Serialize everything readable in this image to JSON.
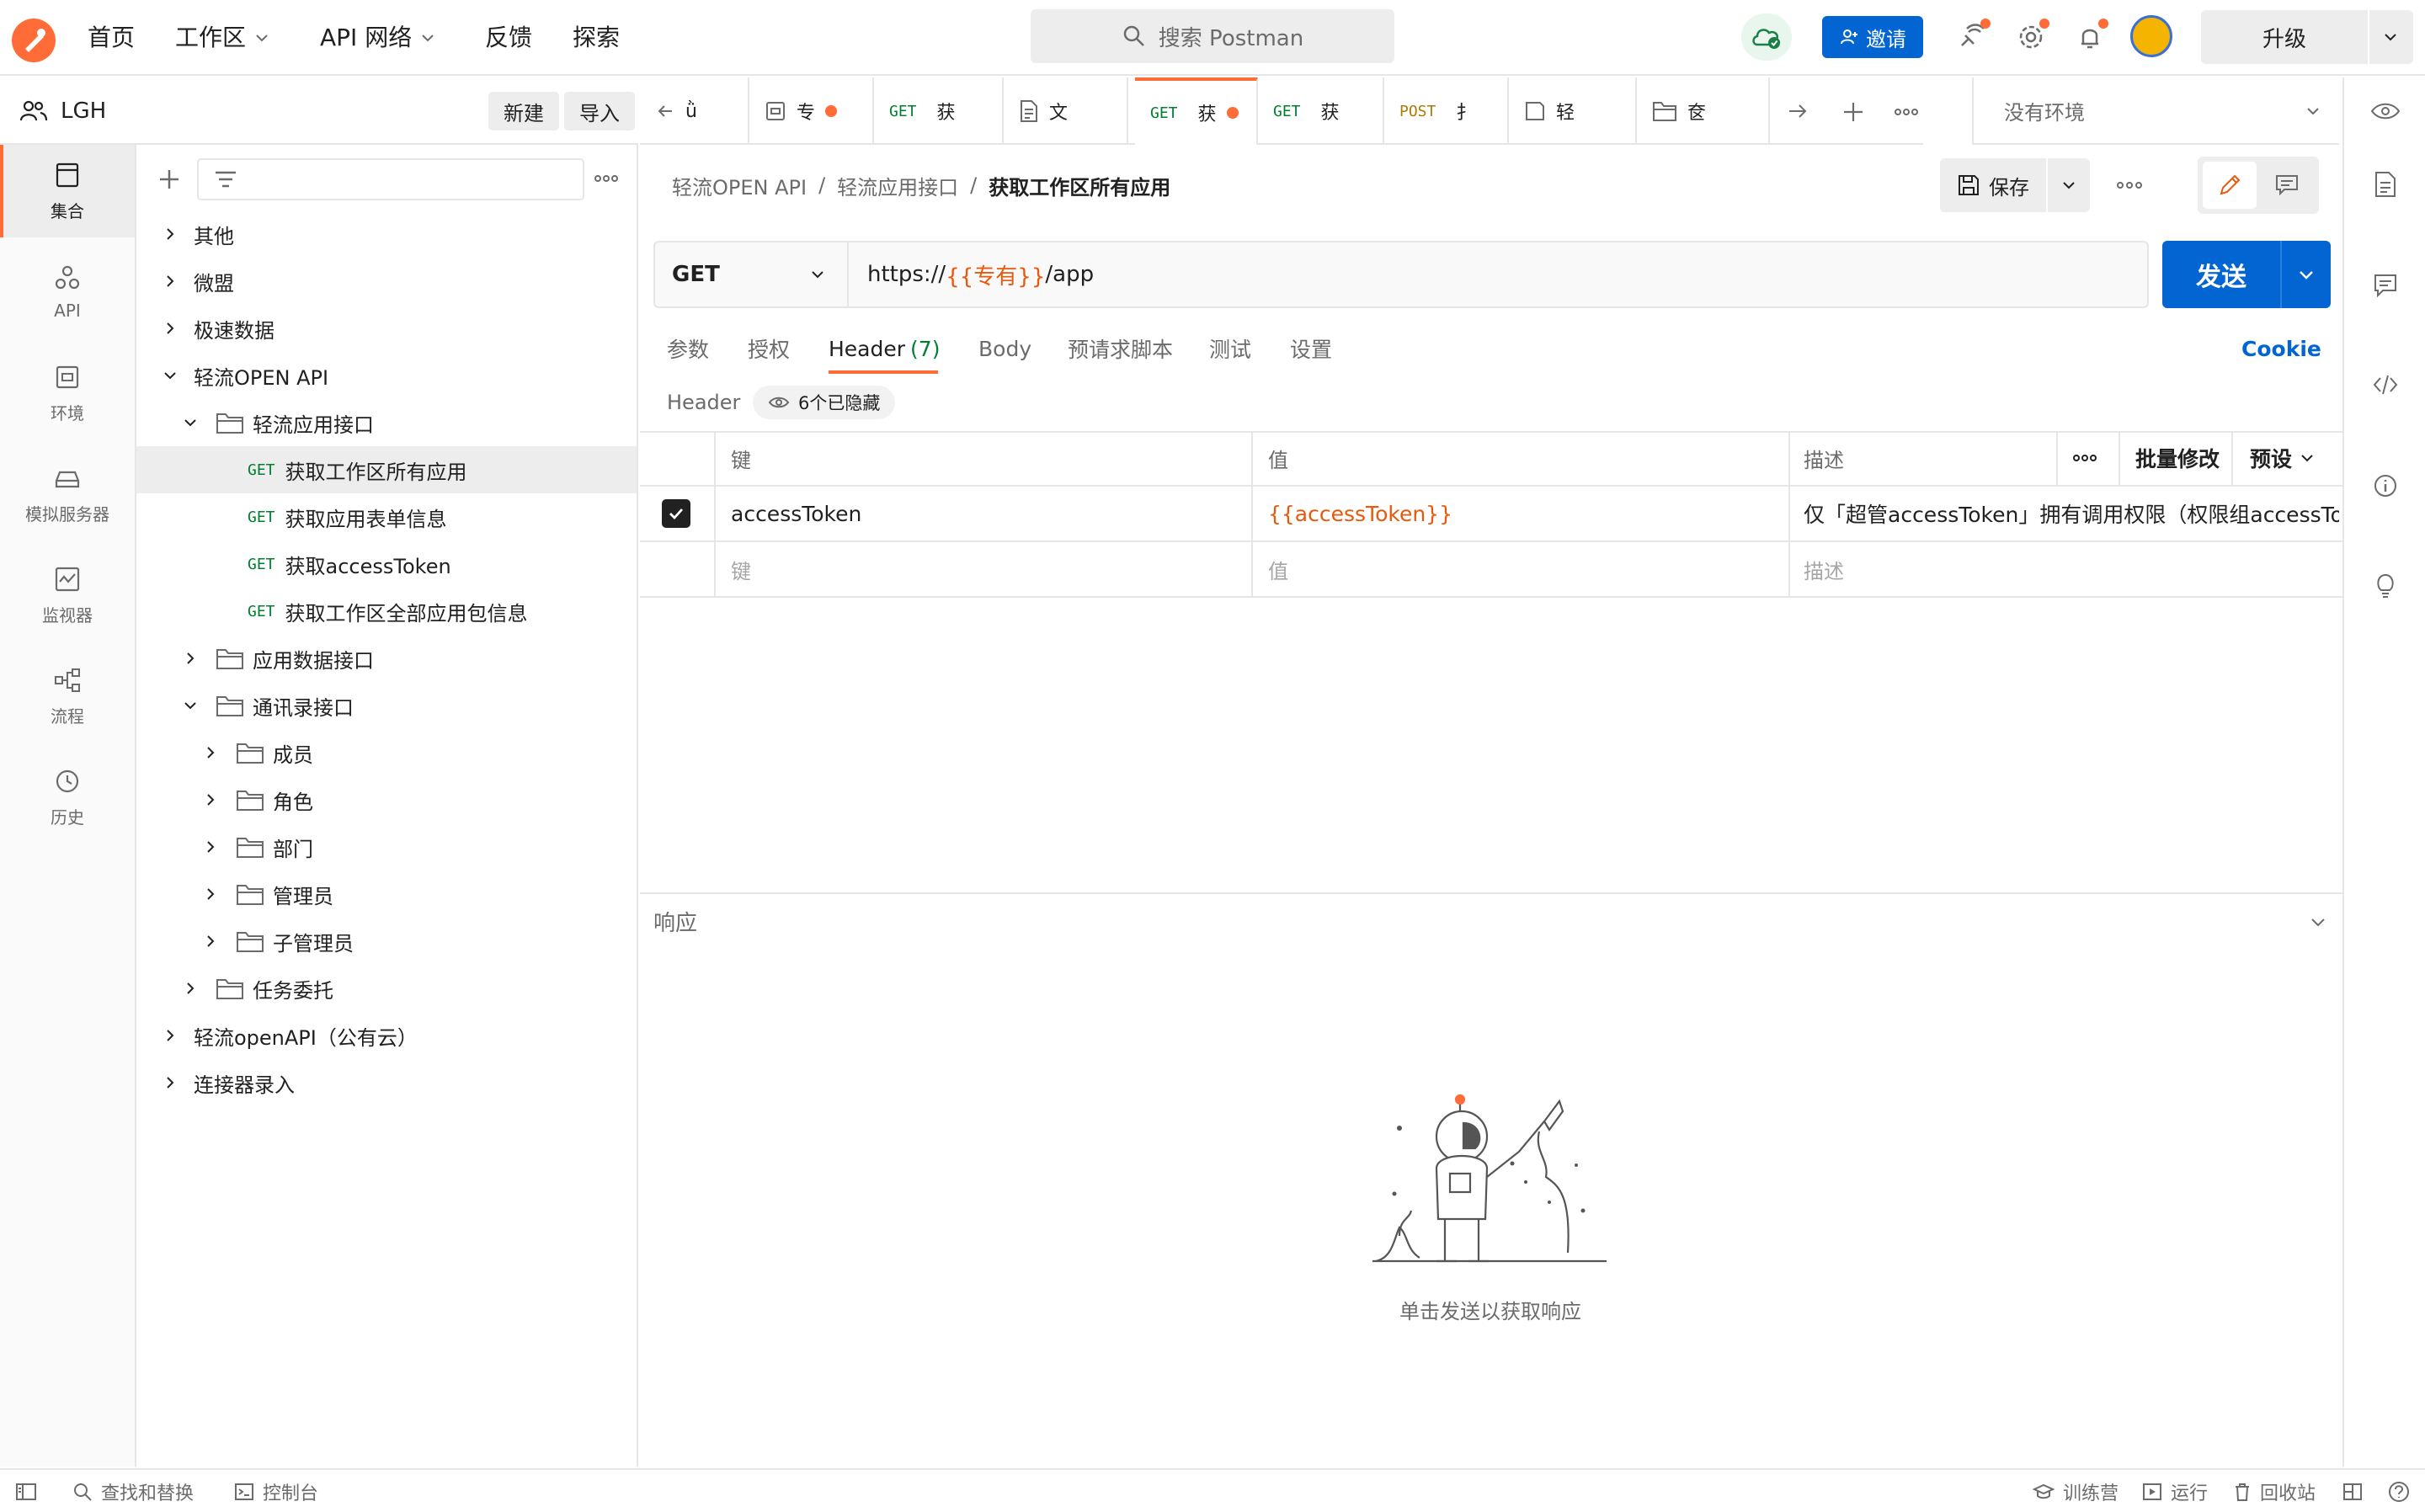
{
  "topnav": {
    "home": "首页",
    "workspaces": "工作区",
    "api_network": "API 网络",
    "feedback": "反馈",
    "explore": "探索",
    "search_placeholder": "搜索 Postman",
    "invite": "邀请",
    "upgrade": "升级"
  },
  "workspace": {
    "name": "LGH",
    "new_btn": "新建",
    "import_btn": "导入"
  },
  "rail": [
    {
      "label": "集合",
      "icon": "collections-icon"
    },
    {
      "label": "API",
      "icon": "api-icon"
    },
    {
      "label": "环境",
      "icon": "environment-icon"
    },
    {
      "label": "模拟服务器",
      "icon": "mock-server-icon"
    },
    {
      "label": "监视器",
      "icon": "monitor-icon"
    },
    {
      "label": "流程",
      "icon": "flow-icon"
    },
    {
      "label": "历史",
      "icon": "history-icon"
    }
  ],
  "tree": [
    {
      "label": "其他"
    },
    {
      "label": "微盟"
    },
    {
      "label": "极速数据"
    },
    {
      "label": "轻流OPEN API"
    },
    {
      "label": "轻流应用接口"
    },
    {
      "method": "GET",
      "label": "获取工作区所有应用"
    },
    {
      "method": "GET",
      "label": "获取应用表单信息"
    },
    {
      "method": "GET",
      "label": "获取accessToken"
    },
    {
      "method": "GET",
      "label": "获取工作区全部应用包信息"
    },
    {
      "label": "应用数据接口"
    },
    {
      "label": "通讯录接口"
    },
    {
      "label": "成员"
    },
    {
      "label": "角色"
    },
    {
      "label": "部门"
    },
    {
      "label": "管理员"
    },
    {
      "label": "子管理员"
    },
    {
      "label": "任务委托"
    },
    {
      "label": "轻流openAPI（公有云）"
    },
    {
      "label": "连接器录入"
    }
  ],
  "tabs": [
    {
      "method": "",
      "label": "ǜ"
    },
    {
      "method": "",
      "label": "专"
    },
    {
      "method": "GET",
      "label": "获"
    },
    {
      "method": "",
      "label": "文"
    },
    {
      "method": "GET",
      "label": "获"
    },
    {
      "method": "GET",
      "label": "获"
    },
    {
      "method": "POST",
      "label": "扌"
    },
    {
      "method": "",
      "label": "轻"
    },
    {
      "method": "",
      "label": "奁"
    }
  ],
  "environment": "没有环境",
  "breadcrumb": {
    "collection": "轻流OPEN API",
    "folder": "轻流应用接口",
    "request": "获取工作区所有应用",
    "sep": "/"
  },
  "save": "保存",
  "request": {
    "method": "GET",
    "url_prefix": "https://",
    "url_var": "{{专有}}",
    "url_suffix": "/app",
    "send": "发送"
  },
  "req_tabs": {
    "params": "参数",
    "auth": "授权",
    "headers": "Header",
    "headers_count": "(7)",
    "body": "Body",
    "pre_script": "预请求脚本",
    "tests": "测试",
    "settings": "设置",
    "cookie": "Cookie"
  },
  "headers_section": {
    "title": "Header",
    "hidden": "6个已隐藏"
  },
  "headers_table": {
    "col_key": "键",
    "col_value": "值",
    "col_desc": "描述",
    "bulk_edit": "批量修改",
    "presets": "预设",
    "rows": [
      {
        "checked": true,
        "key": "accessToken",
        "value": "{{accessToken}}",
        "desc": "仅「超管accessToken」拥有调用权限（权限组accessTo..."
      }
    ],
    "placeholder_key": "键",
    "placeholder_value": "值",
    "placeholder_desc": "描述"
  },
  "response": {
    "title": "响应",
    "empty": "单击发送以获取响应"
  },
  "statusbar": {
    "find_replace": "查找和替换",
    "console": "控制台",
    "bootcamp": "训练营",
    "runner": "运行",
    "trash": "回收站"
  },
  "colors": {
    "accent": "#ff6c37",
    "primary_blue": "#0265d2",
    "get_green": "#007f31",
    "post_amber": "#ad7a03",
    "variable_orange": "#e8590c"
  }
}
